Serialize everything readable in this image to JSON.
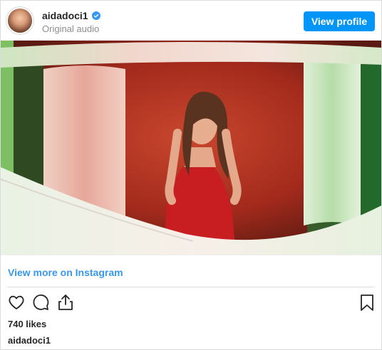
{
  "header": {
    "username": "aidadoci1",
    "subtitle": "Original audio",
    "verified_icon": "verified-badge-icon",
    "view_profile_label": "View profile"
  },
  "media": {
    "kind": "video-still",
    "colors": {
      "wall": "#b8301f",
      "curtain_left": "#e8b2a8",
      "curtain_right": "#cfe8c4",
      "dress": "#c81e22"
    }
  },
  "link": {
    "view_more_label": "View more on Instagram"
  },
  "actions": {
    "like_icon": "heart-icon",
    "comment_icon": "comment-icon",
    "share_icon": "share-icon",
    "save_icon": "bookmark-icon"
  },
  "likes_text": "740 likes",
  "caption_username": "aidadoci1",
  "colors": {
    "accent": "#0095f6",
    "link": "#3897f0",
    "text": "#262626",
    "muted": "#8e8e8e",
    "border": "#dbdbdb"
  }
}
